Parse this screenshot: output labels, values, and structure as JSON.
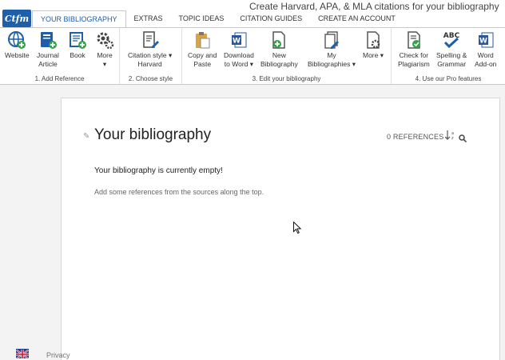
{
  "app": {
    "logo": "Cite This For Me",
    "logo_text": "Ctfm",
    "window_title": "Create Harvard, APA, & MLA citations for your bibliography"
  },
  "tabs": [
    {
      "label": "YOUR BIBLIOGRAPHY",
      "active": true
    },
    {
      "label": "EXTRAS"
    },
    {
      "label": "TOPIC IDEAS"
    },
    {
      "label": "CITATION GUIDES"
    },
    {
      "label": "CREATE AN ACCOUNT"
    }
  ],
  "ribbon": {
    "add_reference": {
      "label": "1. Add Reference",
      "buttons": [
        {
          "label": "Website",
          "icon": "globe-add-icon"
        },
        {
          "label": "Journal\nArticle",
          "icon": "journal-add-icon"
        },
        {
          "label": "Book",
          "icon": "book-add-icon"
        },
        {
          "label": "More\n▾",
          "icon": "gears-icon"
        }
      ]
    },
    "choose_style": {
      "label": "2. Choose style",
      "buttons": [
        {
          "label": "Citation style ▾\nHarvard",
          "icon": "document-pencil-icon"
        }
      ]
    },
    "edit_bibliography": {
      "label": "3. Edit your bibliography",
      "buttons": [
        {
          "label": "Copy and\nPaste",
          "icon": "clipboard-icon"
        },
        {
          "label": "Download\nto Word ▾",
          "icon": "word-icon"
        },
        {
          "label": "New\nBibliography",
          "icon": "new-document-icon"
        },
        {
          "label": "My\nBibliographies ▾",
          "icon": "documents-pencil-icon"
        },
        {
          "label": "More ▾",
          "icon": "document-gear-icon"
        }
      ]
    },
    "pro_features": {
      "label": "4. Use our Pro features",
      "buttons": [
        {
          "label": "Check for\nPlagiarism",
          "icon": "plagiarism-check-icon"
        },
        {
          "label": "Spelling &\nGrammar",
          "icon": "abc-check-icon",
          "icon_text": "ABC"
        },
        {
          "label": "Word\nAdd-on",
          "icon": "word-addon-icon"
        }
      ]
    }
  },
  "document": {
    "title": "Your bibliography",
    "ref_count": "0 REFERENCES ·",
    "sort_label": "↓a/z",
    "empty_message": "Your bibliography is currently empty!",
    "hint": "Add some references from the sources along the top."
  },
  "footer": {
    "privacy": "Privacy",
    "language": "English (UK)"
  },
  "colors": {
    "accent": "#1f5ea8",
    "green": "#3aa04b",
    "word_blue": "#2b5797"
  }
}
